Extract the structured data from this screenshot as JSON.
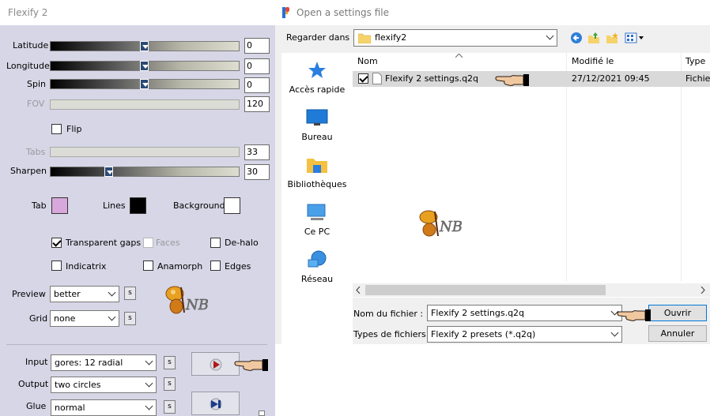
{
  "flexify": {
    "title": "Flexify 2",
    "sliders": [
      {
        "label": "Latitude",
        "value": "0",
        "enabled": true
      },
      {
        "label": "Longitude",
        "value": "0",
        "enabled": true
      },
      {
        "label": "Spin",
        "value": "0",
        "enabled": true
      },
      {
        "label": "FOV",
        "value": "120",
        "enabled": false
      },
      {
        "label": "Tabs",
        "value": "33",
        "enabled": false
      },
      {
        "label": "Sharpen",
        "value": "30",
        "enabled": true
      }
    ],
    "flip_label": "Flip",
    "colors": {
      "tab_label": "Tab",
      "tab_color": "#d8a8dc",
      "lines_label": "Lines",
      "lines_color": "#000000",
      "background_label": "Background",
      "background_color": "#ffffff"
    },
    "options": {
      "transparent_gaps": "Transparent gaps",
      "faces": "Faces",
      "de_halo": "De-halo",
      "indicatrix": "Indicatrix",
      "anamorph": "Anamorph",
      "edges": "Edges"
    },
    "preview_label": "Preview",
    "preview_value": "better",
    "grid_label": "Grid",
    "grid_value": "none",
    "input_label": "Input",
    "input_value": "gores: 12 radial",
    "output_label": "Output",
    "output_value": "two circles",
    "glue_label": "Glue",
    "glue_value": "normal",
    "s_label": "s",
    "logo_text": "NB"
  },
  "dialog": {
    "title": "Open a settings file",
    "look_in_label": "Regarder dans :",
    "look_in_value": "flexify2",
    "places": [
      "Accès rapide",
      "Bureau",
      "Bibliothèques",
      "Ce PC",
      "Réseau"
    ],
    "columns": [
      "Nom",
      "Modifié le",
      "Type"
    ],
    "file": {
      "name": "Flexify 2 settings.q2q",
      "modified": "27/12/2021 09:45",
      "type": "Fichie"
    },
    "filename_label": "Nom du fichier :",
    "filename_value": "Flexify 2 settings.q2q",
    "filetype_label": "Types de fichiers :",
    "filetype_value": "Flexify 2 presets (*.q2q)",
    "open_button": "Ouvrir",
    "cancel_button": "Annuler",
    "watermark_text": "NB"
  }
}
